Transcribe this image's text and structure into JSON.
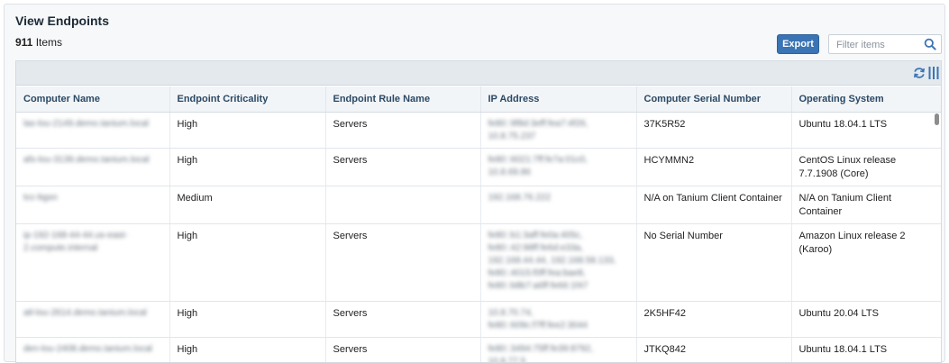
{
  "header": {
    "title": "View Endpoints",
    "count_value": "911",
    "count_label": "Items"
  },
  "toolbar": {
    "export_label": "Export",
    "filter_placeholder": "Filter items"
  },
  "grid": {
    "columns": [
      "Computer Name",
      "Endpoint Criticality",
      "Endpoint Rule Name",
      "IP Address",
      "Computer Serial Number",
      "Operating System"
    ],
    "rows": [
      {
        "computer_name": "las-lou-2149.demo.tanium.local",
        "criticality": "High",
        "rule_name": "Servers",
        "ip_address": "fe80::9f8d:3eff:fea7:4f26, 10.8.75.237",
        "serial": "37K5R52",
        "os": "Ubuntu 18.04.1 LTS"
      },
      {
        "computer_name": "afs-lou-3139.demo.tanium.local",
        "criticality": "High",
        "rule_name": "Servers",
        "ip_address": "fe80::6021:7ff:fe7a:01c0, 10.8.69.86",
        "serial": "HCYMMN2",
        "os": "CentOS Linux release 7.7.1908 (Core)"
      },
      {
        "computer_name": "tcc-bgsn",
        "criticality": "Medium",
        "rule_name": "",
        "ip_address": "192.168.76.222",
        "serial": "N/A on Tanium Client Container",
        "os": "N/A on Tanium Client Container"
      },
      {
        "computer_name": "ip-192-168-44-44.us-east-2.compute.internal",
        "criticality": "High",
        "rule_name": "Servers",
        "ip_address": "fe80::b1:3aff:fe0a:405c, fe80::42:98ff:fe6d:e33a, 192.168.44.44, 192.168.58.133, fe80::4015:f0ff:fea:bae8, fe80::b8b7:a6ff:fe66:1f47",
        "serial": "No Serial Number",
        "os": "Amazon Linux release 2 (Karoo)"
      },
      {
        "computer_name": "atl-lou-2614.demo.tanium.local",
        "criticality": "High",
        "rule_name": "Servers",
        "ip_address": "10.8.70.74, fe80::609c:f7ff:fee2:3044",
        "serial": "2K5HF42",
        "os": "Ubuntu 20.04 LTS"
      },
      {
        "computer_name": "den-lou-2408.demo.tanium.local",
        "criticality": "High",
        "rule_name": "Servers",
        "ip_address": "fe80::3494:75ff:fe39:8792, 10.8.77.5",
        "serial": "JTKQ842",
        "os": "Ubuntu 18.04.1 LTS"
      }
    ]
  },
  "icons": {
    "search": "search-icon",
    "refresh": "refresh-icon",
    "columns": "columns-icon"
  },
  "colors": {
    "accent": "#3a74b4",
    "header_text": "#2b4964"
  }
}
